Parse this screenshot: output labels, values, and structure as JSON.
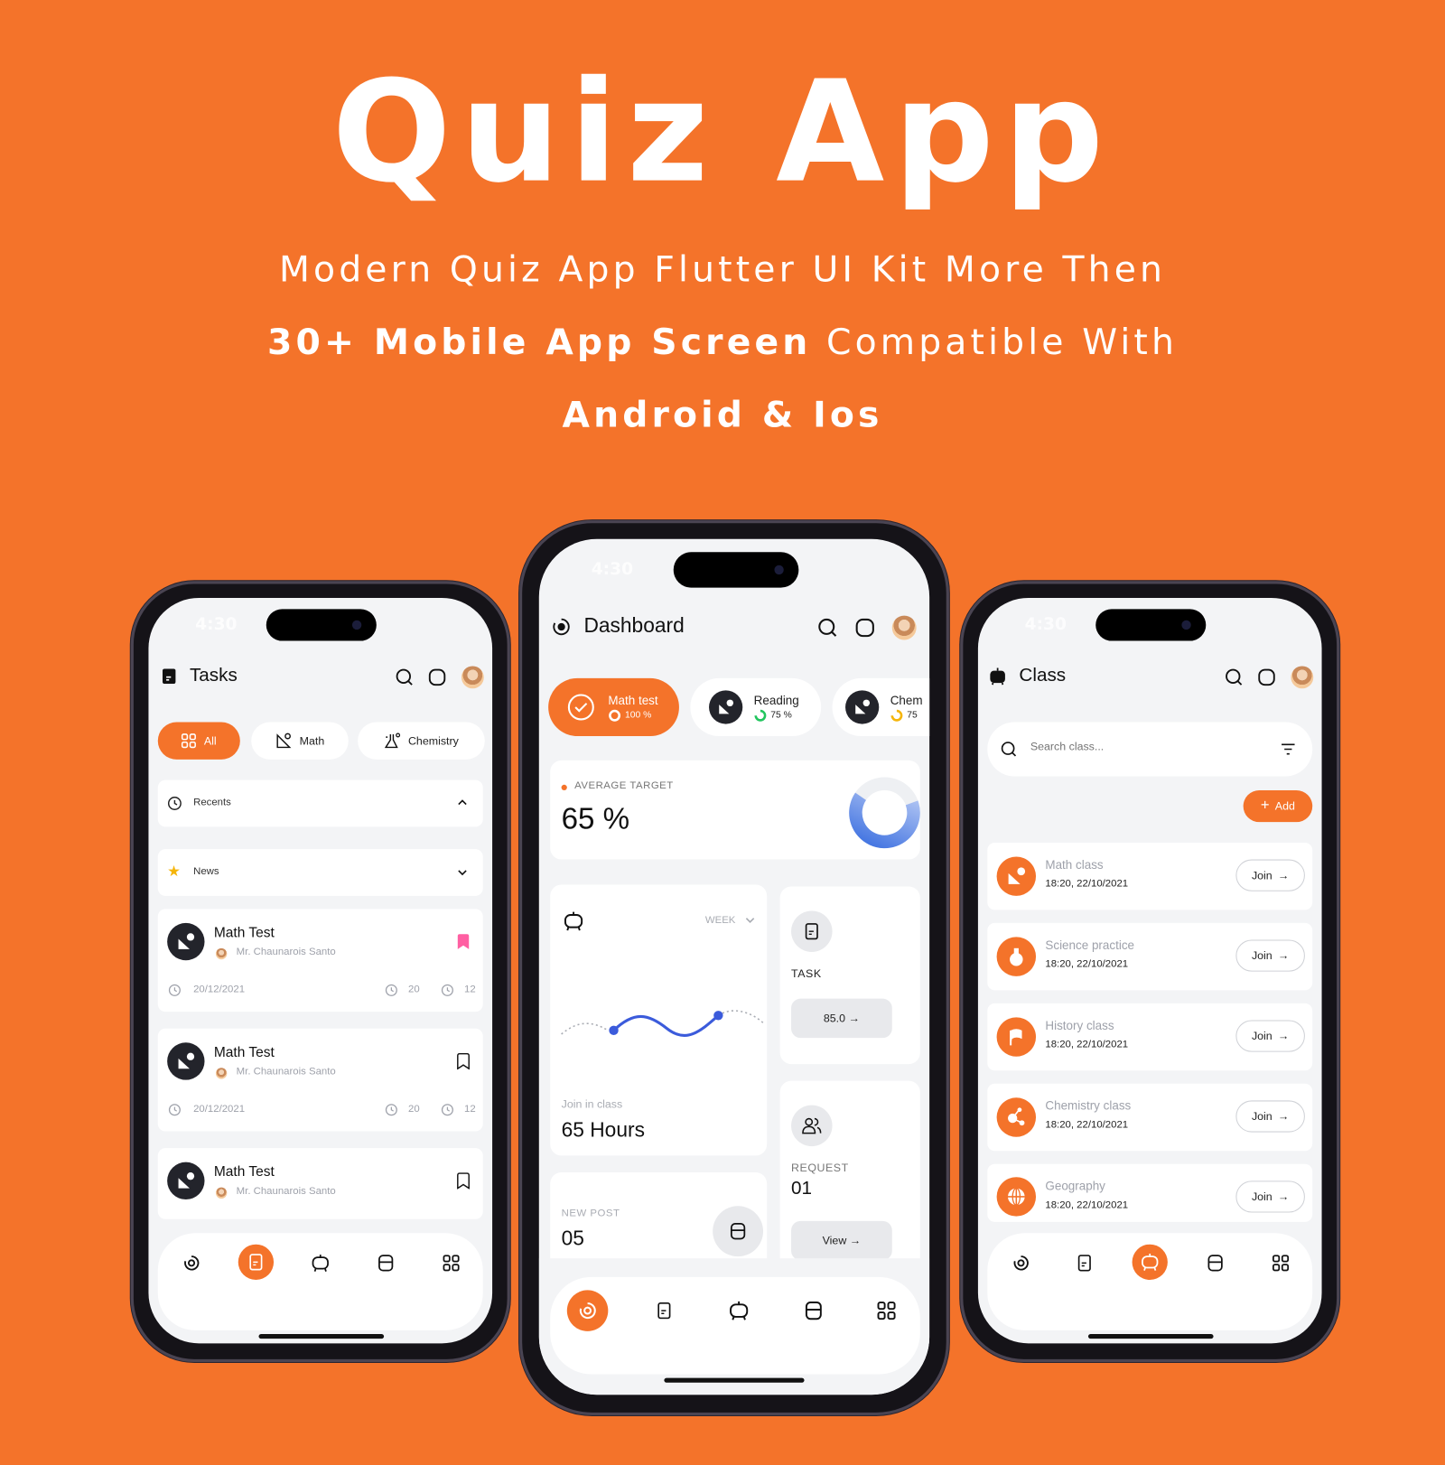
{
  "hero": {
    "title": "Quiz App",
    "line1": "Modern Quiz App Flutter UI Kit More Then",
    "line2_bold": "30+ Mobile App Screen",
    "line2_rest": " Compatible With",
    "line3": "Android & Ios"
  },
  "colors": {
    "brand": "#F4732A",
    "bg": "#F3F4F6",
    "dark": "#23242b",
    "chart_blue": "#3B5BDB",
    "bookmark_pink": "#FF5FA2"
  },
  "status_bar": {
    "time": "4:30"
  },
  "tasks_screen": {
    "title": "Tasks",
    "header_icons": [
      "search-icon",
      "chat-icon",
      "avatar"
    ],
    "filters": [
      {
        "label": "All",
        "icon": "grid-icon",
        "active": true
      },
      {
        "label": "Math",
        "icon": "geometry-icon",
        "active": false
      },
      {
        "label": "Chemistry",
        "icon": "flask-icon",
        "active": false
      }
    ],
    "sections": [
      {
        "label": "Recents",
        "icon": "clock-icon",
        "expanded": true
      },
      {
        "label": "News",
        "icon": "star-icon",
        "expanded": false
      }
    ],
    "items": [
      {
        "title": "Math Test",
        "author": "Mr. Chaunarois Santo",
        "date": "20/12/2021",
        "count1": "20",
        "count2": "12",
        "bookmarked": true
      },
      {
        "title": "Math Test",
        "author": "Mr. Chaunarois Santo",
        "date": "20/12/2021",
        "count1": "20",
        "count2": "12",
        "bookmarked": false
      },
      {
        "title": "Math Test",
        "author": "Mr. Chaunarois Santo",
        "bookmarked": false
      }
    ],
    "nav_active": 1
  },
  "dashboard_screen": {
    "title": "Dashboard",
    "chips": [
      {
        "label": "Math test",
        "progress_text": "100 %",
        "progress": 100,
        "active": true
      },
      {
        "label": "Reading",
        "progress_text": "75 %",
        "progress": 75,
        "active": false
      },
      {
        "label": "Chem",
        "progress_text": "75",
        "progress": 75,
        "active": false
      }
    ],
    "average_target": {
      "label": "AVERAGE TARGET",
      "value": "65 %",
      "percent": 65
    },
    "join_card": {
      "period": "WEEK",
      "label": "Join in class",
      "value": "65 Hours"
    },
    "task_card": {
      "label": "TASK",
      "button": "85.0 →"
    },
    "request_card": {
      "label": "REQUEST",
      "value": "01",
      "button": "View →"
    },
    "new_post_card": {
      "label": "NEW POST",
      "value": "05"
    },
    "nav_active": 0
  },
  "class_screen": {
    "title": "Class",
    "search_placeholder": "Search class...",
    "add_label": "Add",
    "classes": [
      {
        "name": "Math class",
        "time": "18:20, 22/10/2021",
        "icon": "geometry-icon",
        "join": "Join"
      },
      {
        "name": "Science practice",
        "time": "18:20, 22/10/2021",
        "icon": "flask-icon",
        "join": "Join"
      },
      {
        "name": "History class",
        "time": "18:20, 22/10/2021",
        "icon": "flag-icon",
        "join": "Join"
      },
      {
        "name": "Chemistry class",
        "time": "18:20, 22/10/2021",
        "icon": "molecule-icon",
        "join": "Join"
      },
      {
        "name": "Geography",
        "time": "18:20, 22/10/2021",
        "icon": "globe-icon",
        "join": "Join"
      }
    ],
    "nav_active": 2
  },
  "nav_items": [
    "dashboard-icon",
    "tasks-icon",
    "class-icon",
    "posts-icon",
    "apps-icon"
  ]
}
